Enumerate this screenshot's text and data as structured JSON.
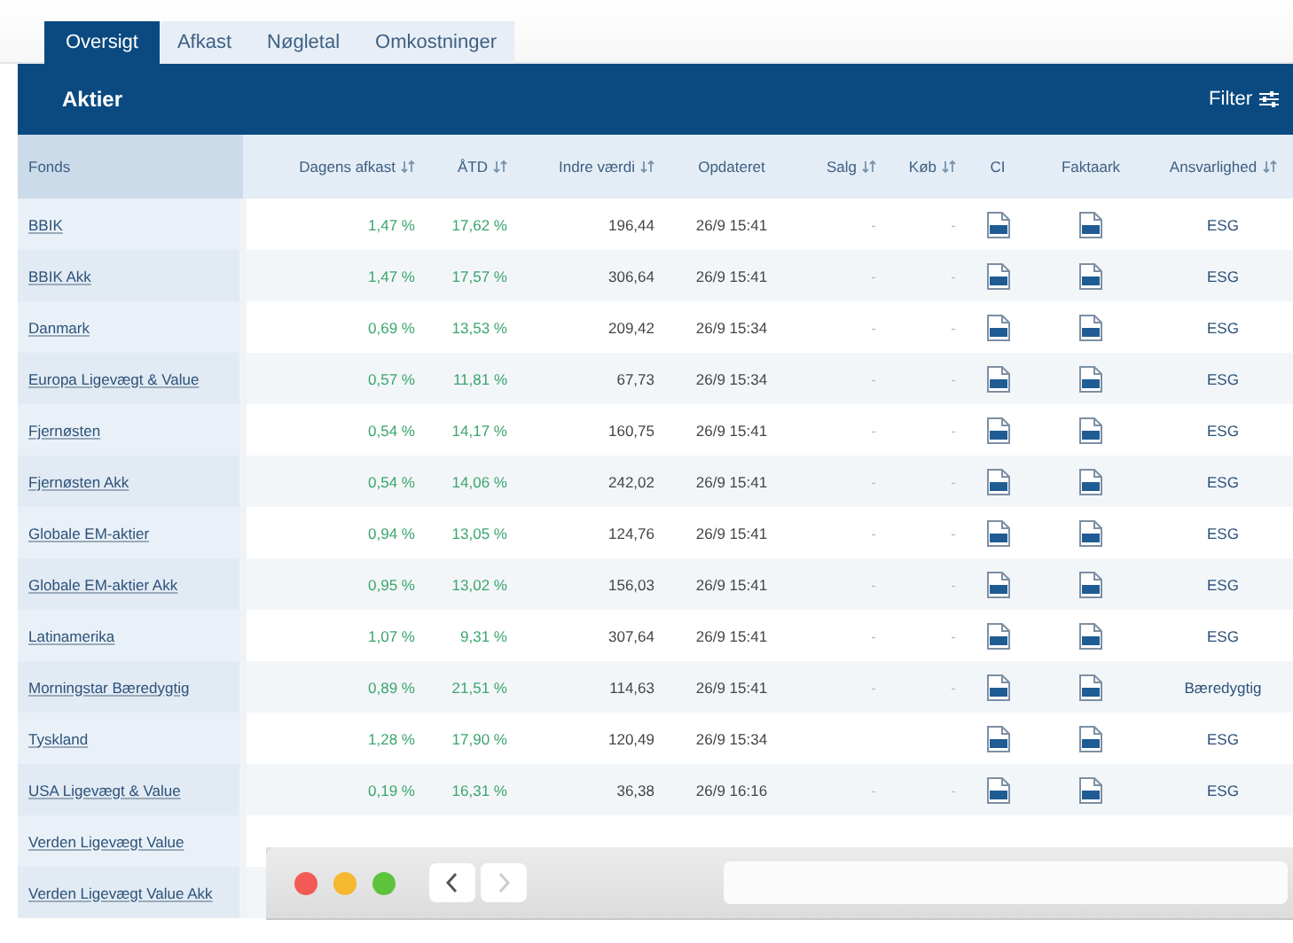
{
  "tabs": [
    {
      "label": "Oversigt",
      "selected": true
    },
    {
      "label": "Afkast",
      "selected": false
    },
    {
      "label": "Nøgletal",
      "selected": false
    },
    {
      "label": "Omkostninger",
      "selected": false
    }
  ],
  "section": {
    "title": "Aktier",
    "filter_label": "Filter"
  },
  "table": {
    "columns": [
      {
        "label": "Fonds",
        "sortable": false
      },
      {
        "label": "Dagens afkast",
        "sortable": true
      },
      {
        "label": "ÅTD",
        "sortable": true
      },
      {
        "label": "Indre værdi",
        "sortable": true
      },
      {
        "label": "Opdateret",
        "sortable": false
      },
      {
        "label": "Salg",
        "sortable": true
      },
      {
        "label": "Køb",
        "sortable": true
      },
      {
        "label": "CI",
        "sortable": false
      },
      {
        "label": "Faktaark",
        "sortable": false
      },
      {
        "label": "Ansvarlighed",
        "sortable": true
      }
    ],
    "rows": [
      {
        "fonds": "BBIK",
        "dagens_afkast": "1,47 %",
        "atd": "17,62 %",
        "indre_vaerdi": "196,44",
        "opdateret": "26/9 15:41",
        "salg": "-",
        "kob": "-",
        "ci": true,
        "faktaark": true,
        "ansvarlighed": "ESG"
      },
      {
        "fonds": "BBIK Akk",
        "dagens_afkast": "1,47 %",
        "atd": "17,57 %",
        "indre_vaerdi": "306,64",
        "opdateret": "26/9 15:41",
        "salg": "-",
        "kob": "-",
        "ci": true,
        "faktaark": true,
        "ansvarlighed": "ESG"
      },
      {
        "fonds": "Danmark",
        "dagens_afkast": "0,69 %",
        "atd": "13,53 %",
        "indre_vaerdi": "209,42",
        "opdateret": "26/9 15:34",
        "salg": "-",
        "kob": "-",
        "ci": true,
        "faktaark": true,
        "ansvarlighed": "ESG"
      },
      {
        "fonds": "Europa Ligevægt & Value",
        "dagens_afkast": "0,57 %",
        "atd": "11,81 %",
        "indre_vaerdi": "67,73",
        "opdateret": "26/9 15:34",
        "salg": "-",
        "kob": "-",
        "ci": true,
        "faktaark": true,
        "ansvarlighed": "ESG"
      },
      {
        "fonds": "Fjernøsten",
        "dagens_afkast": "0,54 %",
        "atd": "14,17 %",
        "indre_vaerdi": "160,75",
        "opdateret": "26/9 15:41",
        "salg": "-",
        "kob": "-",
        "ci": true,
        "faktaark": true,
        "ansvarlighed": "ESG"
      },
      {
        "fonds": "Fjernøsten Akk",
        "dagens_afkast": "0,54 %",
        "atd": "14,06 %",
        "indre_vaerdi": "242,02",
        "opdateret": "26/9 15:41",
        "salg": "-",
        "kob": "-",
        "ci": true,
        "faktaark": true,
        "ansvarlighed": "ESG"
      },
      {
        "fonds": "Globale EM-aktier",
        "dagens_afkast": "0,94 %",
        "atd": "13,05 %",
        "indre_vaerdi": "124,76",
        "opdateret": "26/9 15:41",
        "salg": "-",
        "kob": "-",
        "ci": true,
        "faktaark": true,
        "ansvarlighed": "ESG"
      },
      {
        "fonds": "Globale EM-aktier Akk",
        "dagens_afkast": "0,95 %",
        "atd": "13,02 %",
        "indre_vaerdi": "156,03",
        "opdateret": "26/9 15:41",
        "salg": "-",
        "kob": "-",
        "ci": true,
        "faktaark": true,
        "ansvarlighed": "ESG"
      },
      {
        "fonds": "Latinamerika",
        "dagens_afkast": "1,07 %",
        "atd": "9,31 %",
        "indre_vaerdi": "307,64",
        "opdateret": "26/9 15:41",
        "salg": "-",
        "kob": "-",
        "ci": true,
        "faktaark": true,
        "ansvarlighed": "ESG"
      },
      {
        "fonds": "Morningstar Bæredygtig",
        "dagens_afkast": "0,89 %",
        "atd": "21,51 %",
        "indre_vaerdi": "114,63",
        "opdateret": "26/9 15:41",
        "salg": "-",
        "kob": "-",
        "ci": true,
        "faktaark": true,
        "ansvarlighed": "Bæredygtig"
      },
      {
        "fonds": "Tyskland",
        "dagens_afkast": "1,28 %",
        "atd": "17,90 %",
        "indre_vaerdi": "120,49",
        "opdateret": "26/9 15:34",
        "ci": true,
        "faktaark": true,
        "ansvarlighed": "ESG"
      },
      {
        "fonds": "USA Ligevægt & Value",
        "dagens_afkast": "0,19 %",
        "atd": "16,31 %",
        "indre_vaerdi": "36,38",
        "opdateret": "26/9 16:16",
        "salg": "-",
        "kob": "-",
        "ci": true,
        "faktaark": true,
        "ansvarlighed": "ESG"
      },
      {
        "fonds": "Verden Ligevægt Value"
      },
      {
        "fonds": "Verden Ligevægt Value Akk"
      }
    ]
  },
  "browser_window": {
    "back_enabled": true,
    "forward_enabled": false
  }
}
